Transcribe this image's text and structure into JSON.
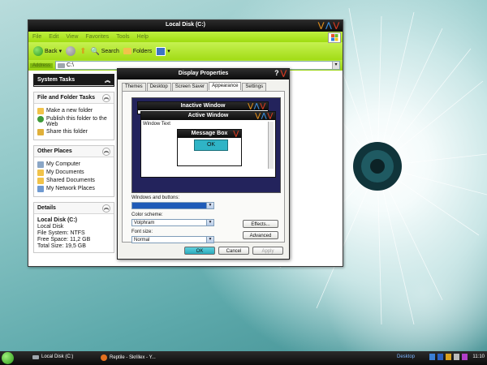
{
  "explorer": {
    "title": "Local Disk (C:)",
    "menu": [
      "File",
      "Edit",
      "View",
      "Favorites",
      "Tools",
      "Help"
    ],
    "toolbar": {
      "back": "Back",
      "search": "Search",
      "folders": "Folders"
    },
    "address_label": "Address",
    "address_value": "C:\\",
    "system_tasks": "System Tasks",
    "file_folder_tasks": {
      "title": "File and Folder Tasks",
      "items": [
        "Make a new folder",
        "Publish this folder to the Web",
        "Share this folder"
      ]
    },
    "other_places": {
      "title": "Other Places",
      "items": [
        "My Computer",
        "My Documents",
        "Shared Documents",
        "My Network Places"
      ]
    },
    "details": {
      "title": "Details",
      "name": "Local Disk (C:)",
      "type": "Local Disk",
      "filesystem": "File System: NTFS",
      "free": "Free Space: 11,2 GB",
      "total": "Total Size: 19,5 GB"
    }
  },
  "dialog": {
    "title": "Display Properties",
    "tabs": [
      "Themes",
      "Desktop",
      "Screen Saver",
      "Appearance",
      "Settings"
    ],
    "active_tab": "Appearance",
    "preview": {
      "inactive": "Inactive Window",
      "active": "Active Window",
      "window_text": "Window Text",
      "message_box": "Message Box",
      "ok": "OK"
    },
    "windows_buttons_label": "Windows and buttons:",
    "windows_buttons_value": "",
    "color_scheme_label": "Color scheme:",
    "color_scheme_value": "Volphram",
    "font_size_label": "Font size:",
    "font_size_value": "Normal",
    "effects": "Effects...",
    "advanced": "Advanced",
    "ok": "OK",
    "cancel": "Cancel",
    "apply": "Apply"
  },
  "taskbar": {
    "items": [
      "Local Disk (C:)",
      "Reptile - Skrillex - Y..."
    ],
    "desktop": "Desktop",
    "clock": "11:10"
  },
  "colors": {
    "accent_green": "#a6de1a",
    "title_dark": "#111111",
    "ok_cyan": "#2fb4c6",
    "preview_blue": "#23235c"
  }
}
